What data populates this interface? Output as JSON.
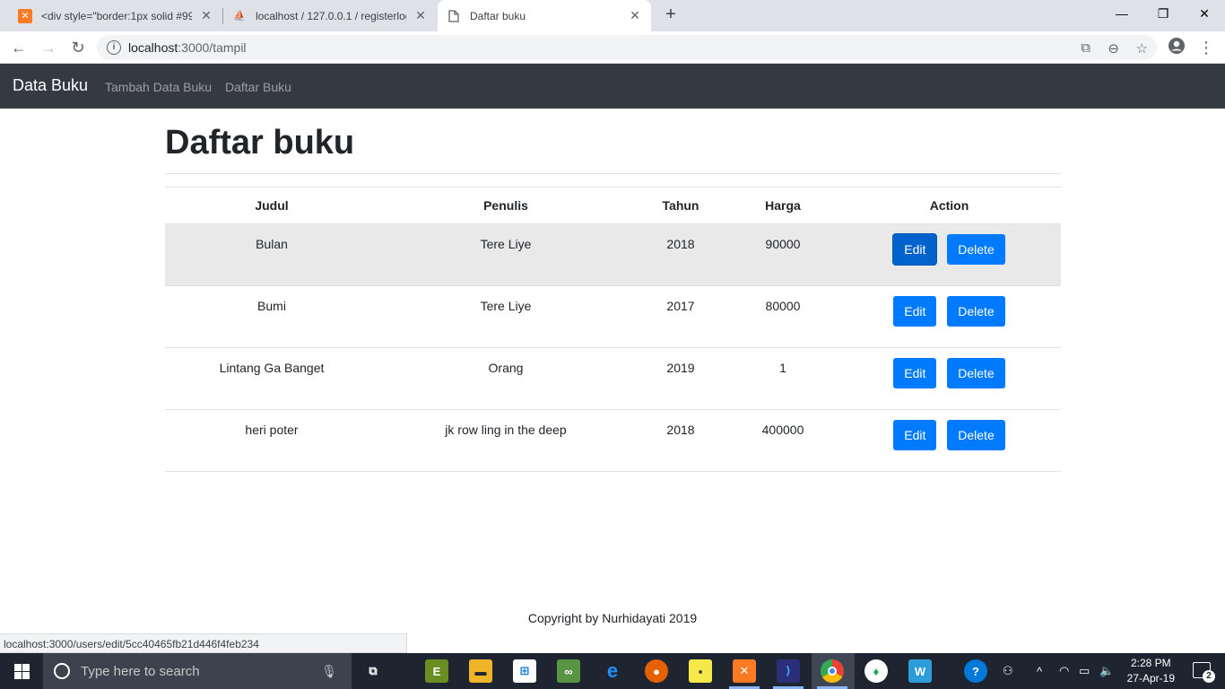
{
  "browser": {
    "tabs": [
      {
        "title": "<div style=\"border:1px solid #99",
        "icon": "xampp-icon"
      },
      {
        "title": "localhost / 127.0.0.1 / registerlog",
        "icon": "phpmyadmin-icon"
      },
      {
        "title": "Daftar buku",
        "icon": "page-icon"
      }
    ],
    "url_host": "localhost",
    "url_path": ":3000/tampil",
    "status_url": "localhost:3000/users/edit/5cc40465fb21d446f4feb234"
  },
  "navbar": {
    "brand": "Data Buku",
    "links": [
      "Tambah Data Buku",
      "Daftar Buku"
    ]
  },
  "page": {
    "title": "Daftar buku",
    "columns": [
      "Judul",
      "Penulis",
      "Tahun",
      "Harga",
      "Action"
    ],
    "rows": [
      {
        "judul": "Bulan",
        "penulis": "Tere Liye",
        "tahun": "2018",
        "harga": "90000"
      },
      {
        "judul": "Bumi",
        "penulis": "Tere Liye",
        "tahun": "2017",
        "harga": "80000"
      },
      {
        "judul": "Lintang Ga Banget",
        "penulis": "Orang",
        "tahun": "2019",
        "harga": "1"
      },
      {
        "judul": "heri poter",
        "penulis": "jk row ling in the deep",
        "tahun": "2018",
        "harga": "400000"
      }
    ],
    "edit_label": "Edit",
    "delete_label": "Delete",
    "footer": "Copyright by Nurhidayati 2019"
  },
  "taskbar": {
    "search_placeholder": "Type here to search",
    "time": "2:28 PM",
    "date": "27-Apr-19",
    "notification_count": "2"
  },
  "colors": {
    "navbar": "#343a40",
    "primary": "#007bff",
    "taskbar": "#1f2530"
  }
}
